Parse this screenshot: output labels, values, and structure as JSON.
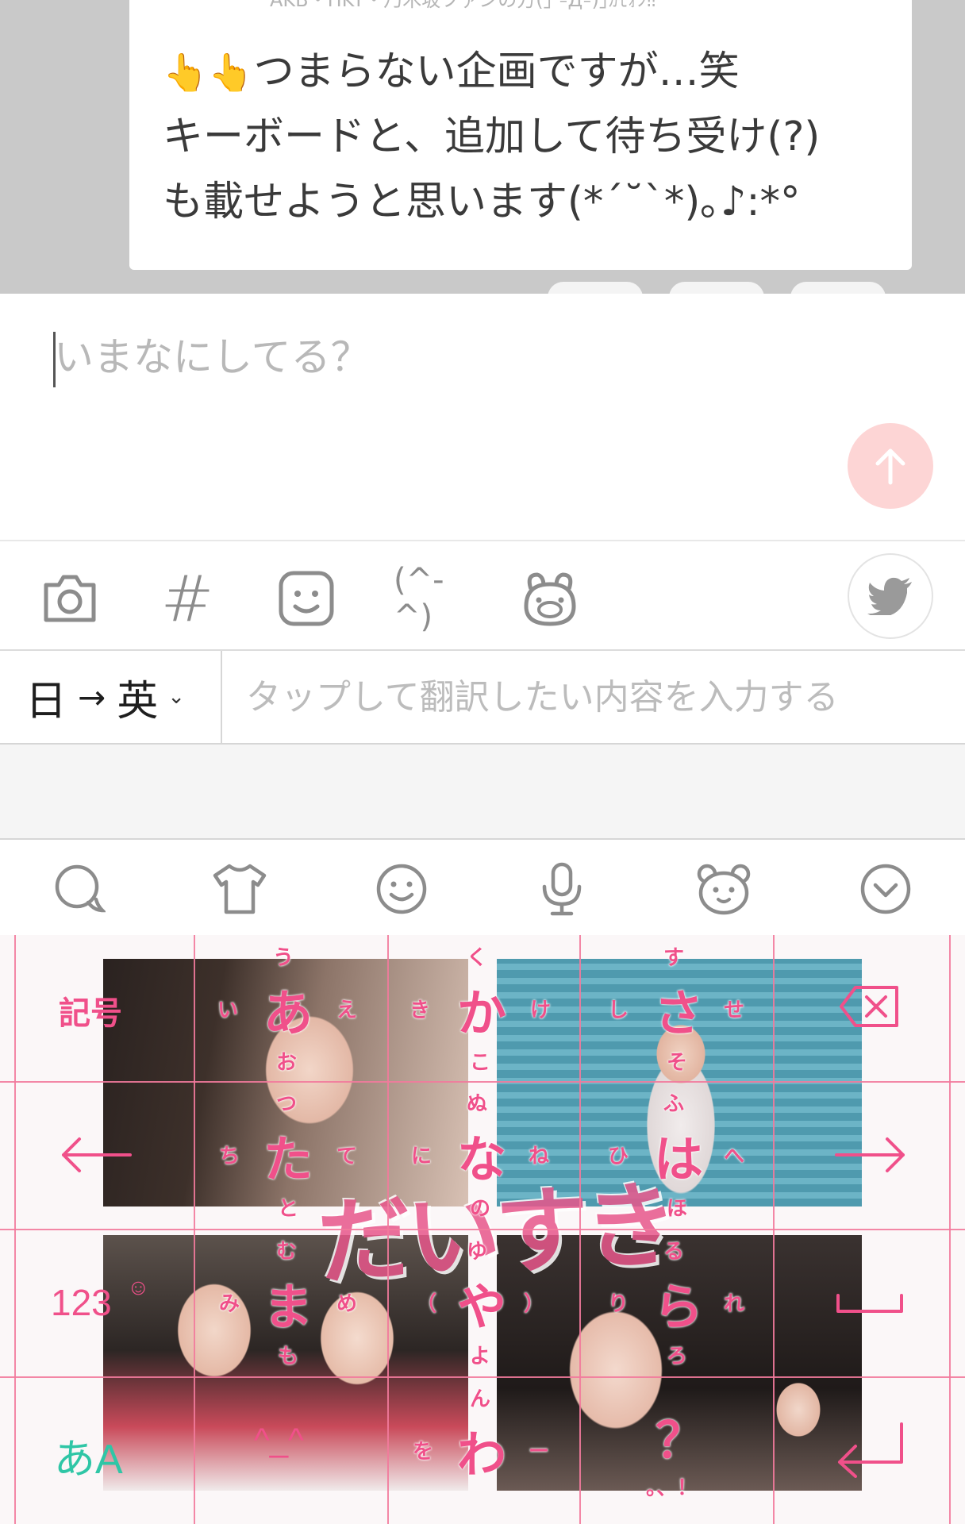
{
  "feed": {
    "post": {
      "author_line": "AKB・HKT・乃木坂ファンの方(｣ ºДº)｣ｶﾓｫﾝ‼",
      "hands": "👆👆",
      "line1": "つまらない企画ですが…笑",
      "line2": "キーボードと、追加して待ち受け(?)",
      "line3": "も載せようと思います(*´˘`*)｡♪:*°"
    }
  },
  "compose": {
    "placeholder": "いまなにしてる？"
  },
  "compose_toolbar": {
    "hashtag": "#",
    "kaomoji": "(^-^)"
  },
  "translate": {
    "source_lang": "日",
    "arrow": "→",
    "target_lang": "英",
    "chevron": "⌄",
    "placeholder": "タップして翻訳したい内容を入力する"
  },
  "keyboard": {
    "keys": {
      "symbols": "記号",
      "numbers": "123",
      "numbers_emoji": "☺",
      "mode": "あA",
      "left": "←",
      "right": "→",
      "delete": "⌫",
      "space": "␣",
      "enter": "↵",
      "kaomoji": "^_^"
    },
    "kana": {
      "a": {
        "main": "あ",
        "up": "う",
        "left": "い",
        "right": "え",
        "down": "お"
      },
      "ka": {
        "main": "か",
        "up": "く",
        "left": "き",
        "right": "け",
        "down": "こ"
      },
      "sa": {
        "main": "さ",
        "up": "す",
        "left": "し",
        "right": "せ",
        "down": "そ"
      },
      "ta": {
        "main": "た",
        "up": "つ",
        "left": "ち",
        "right": "て",
        "down": "と"
      },
      "na": {
        "main": "な",
        "up": "ぬ",
        "left": "に",
        "right": "ね",
        "down": "の"
      },
      "ha": {
        "main": "は",
        "up": "ふ",
        "left": "ひ",
        "right": "へ",
        "down": "ほ"
      },
      "ma": {
        "main": "ま",
        "up": "む",
        "left": "み",
        "right": "め",
        "down": "も"
      },
      "ya": {
        "main": "や",
        "up": "ゆ",
        "left": "（",
        "right": "）",
        "down": "よ"
      },
      "ra": {
        "main": "ら",
        "up": "る",
        "left": "り",
        "right": "れ",
        "down": "ろ"
      },
      "wa": {
        "main": "わ",
        "up": "ん",
        "left": "を",
        "right": "ー"
      },
      "punct": {
        "main": "？",
        "sub": "。、！"
      }
    },
    "banner": "だいすき"
  },
  "colors": {
    "accent": "#f0508a",
    "send_button": "#fdd5d5",
    "icon_grey": "#8c8c8c",
    "twitter_grey": "#9a9a9a",
    "mode_key": "#2fc6a6"
  }
}
